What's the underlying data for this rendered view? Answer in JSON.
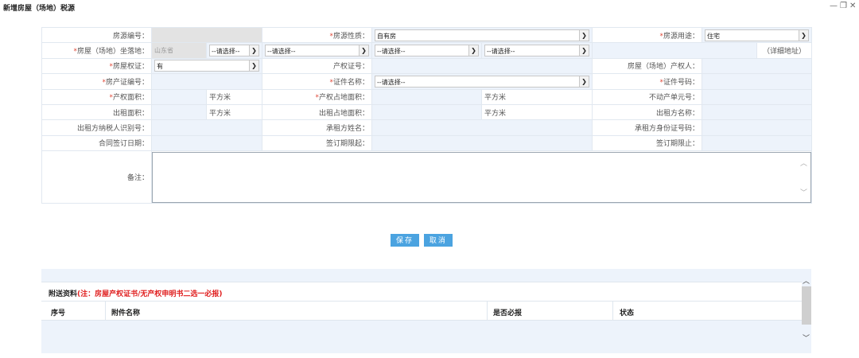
{
  "window": {
    "title": "新增房屋（场地）税源",
    "minimize": "—",
    "maximize": "❐",
    "close": "✕"
  },
  "form": {
    "house_no_label": "房源编号：",
    "nature_label": "房源性质：",
    "nature_value": "自有房",
    "usage_label": "房源用途：",
    "usage_value": "住宅",
    "location_label": "房屋（场地）坐落地：",
    "province": "山东省",
    "select_placeholder": "--请选择--",
    "detail_address": "（详细地址）",
    "cert_label": "房屋权证：",
    "cert_value": "有",
    "property_cert_no_label": "产权证号：",
    "owner_label": "房屋（场地）产权人：",
    "house_cert_no_label": "房产证编号：",
    "id_name_label": "证件名称：",
    "id_no_label": "证件号码：",
    "property_area_label": "产权面积：",
    "unit_sqm": "平方米",
    "property_land_area_label": "产权占地面积：",
    "estate_unit_no_label": "不动产单元号：",
    "rent_area_label": "出租面积：",
    "rent_land_area_label": "出租占地面积：",
    "lessor_name_label": "出租方名称：",
    "lessor_tax_id_label": "出租方纳税人识别号：",
    "lessee_name_label": "承租方姓名：",
    "lessee_id_label": "承租方身份证号码：",
    "contract_date_label": "合同签订日期：",
    "start_date_label": "签订期限起：",
    "end_date_label": "签订期限止：",
    "remark_label": "备注："
  },
  "buttons": {
    "save": "保存",
    "cancel": "取消"
  },
  "attachments": {
    "title": "附送资料",
    "note": "(注：房屋产权证书/无产权申明书二选一必报)",
    "columns": [
      "序号",
      "附件名称",
      "是否必报",
      "状态"
    ]
  }
}
